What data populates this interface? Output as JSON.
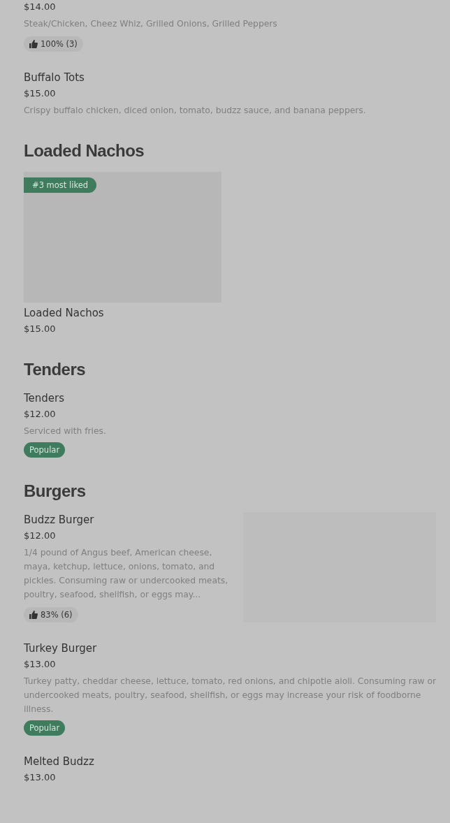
{
  "sections": [
    {
      "items": [
        {
          "price": "$14.00",
          "description": "Steak/Chicken, Cheez Whiz, Grilled Onions, Grilled Peppers",
          "tag": {
            "kind": "rating",
            "text": "100% (3)"
          }
        },
        {
          "name": "Buffalo Tots",
          "price": "$15.00",
          "description": "Crispy buffalo chicken, diced onion, tomato, budzz sauce, and banana peppers."
        }
      ]
    },
    {
      "title": "Loaded Nachos",
      "items": [
        {
          "kind": "card",
          "badge": "#3 most liked",
          "name": "Loaded Nachos",
          "price": "$15.00"
        }
      ]
    },
    {
      "title": "Tenders",
      "items": [
        {
          "name": "Tenders",
          "price": "$12.00",
          "description": "Serviced with fries.",
          "tag": {
            "kind": "popular",
            "text": "Popular"
          }
        }
      ]
    },
    {
      "title": "Burgers",
      "items": [
        {
          "kind": "side",
          "name": "Budzz Burger",
          "price": "$12.00",
          "description": "1/4 pound of Angus beef, American cheese, maya, ketchup, lettuce, onions, tomato, and pickles. Consuming raw or undercooked meats, poultry, seafood, shellfish, or eggs may...",
          "tag": {
            "kind": "rating",
            "text": "83% (6)"
          }
        },
        {
          "name": "Turkey Burger",
          "price": "$13.00",
          "description": "Turkey patty, cheddar cheese, lettuce, tomato, red onions, and chipotle aioli. Consuming raw or undercooked meats, poultry, seafood, shellfish, or eggs may increase your risk of foodborne illness.",
          "tag": {
            "kind": "popular",
            "text": "Popular"
          }
        },
        {
          "name": "Melted Budzz",
          "price": "$13.00"
        }
      ]
    }
  ]
}
